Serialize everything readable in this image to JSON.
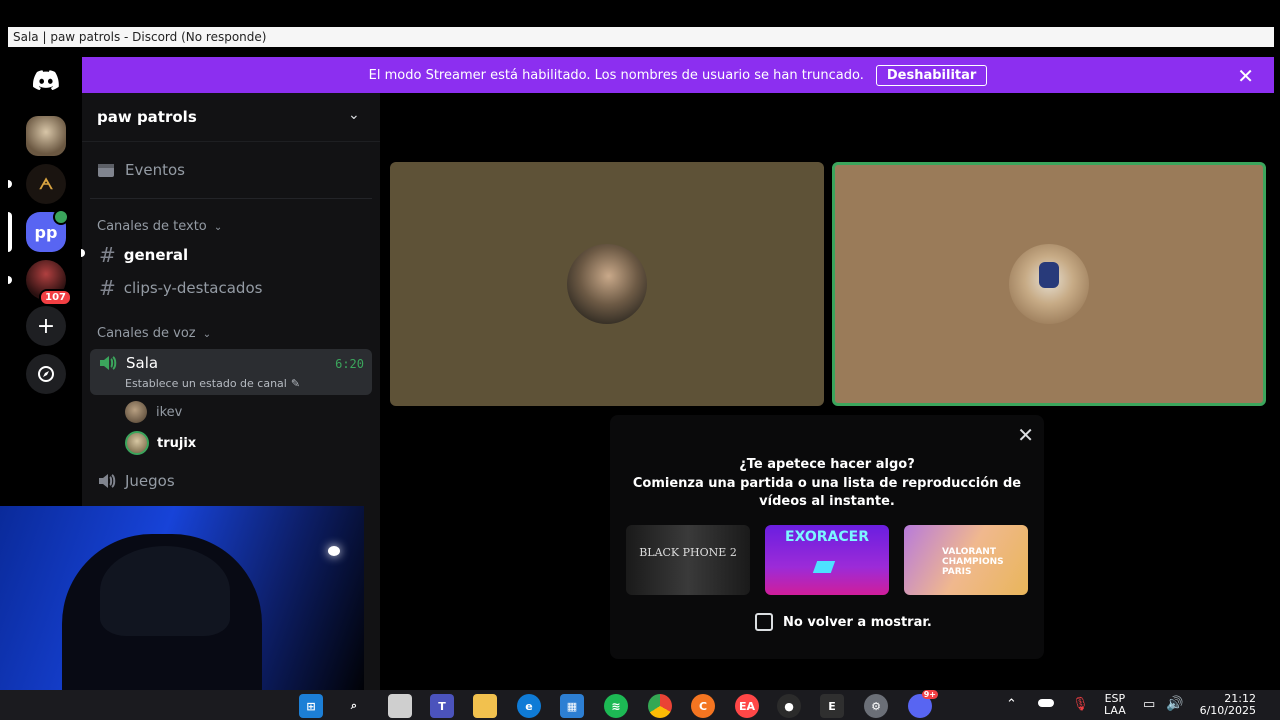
{
  "window": {
    "title": "Sala | paw patrols - Discord (No responde)"
  },
  "banner": {
    "message": "El modo Streamer está habilitado. Los nombres de usuario se han truncado.",
    "button": "Deshabilitar"
  },
  "rail": {
    "badge_count": "107",
    "active_server_initials": "pp"
  },
  "server": {
    "name": "paw patrols",
    "events_label": "Eventos",
    "text_category": "Canales de texto",
    "text_channels": [
      "general",
      "clips-y-destacados"
    ],
    "voice_category": "Canales de voz",
    "voice_channel": {
      "name": "Sala",
      "timer": "6:20",
      "status_placeholder": "Establece un estado de canal"
    },
    "voice_users": [
      "ikev",
      "trujix"
    ],
    "other_voice_channel": "Juegos"
  },
  "activity_prompt": {
    "title": "¿Te apetece hacer algo?",
    "body": "Comienza una partida o una lista de reproducción de vídeos al instante.",
    "games": [
      "BLACK PHONE 2",
      "EXORACER",
      "VALORANT CHAMPIONS PARIS"
    ],
    "checkbox_label": "No volver a mostrar."
  },
  "taskbar": {
    "lang": "ESP",
    "lang_sub": "LAA",
    "time": "21:12",
    "date": "6/10/2025",
    "discord_badge": "9+"
  },
  "colors": {
    "brand": "#5865f2",
    "banner": "#8c2ff0",
    "speaking": "#3ba55c",
    "tile_left": "#5e5237",
    "tile_right": "#9a7b59"
  }
}
